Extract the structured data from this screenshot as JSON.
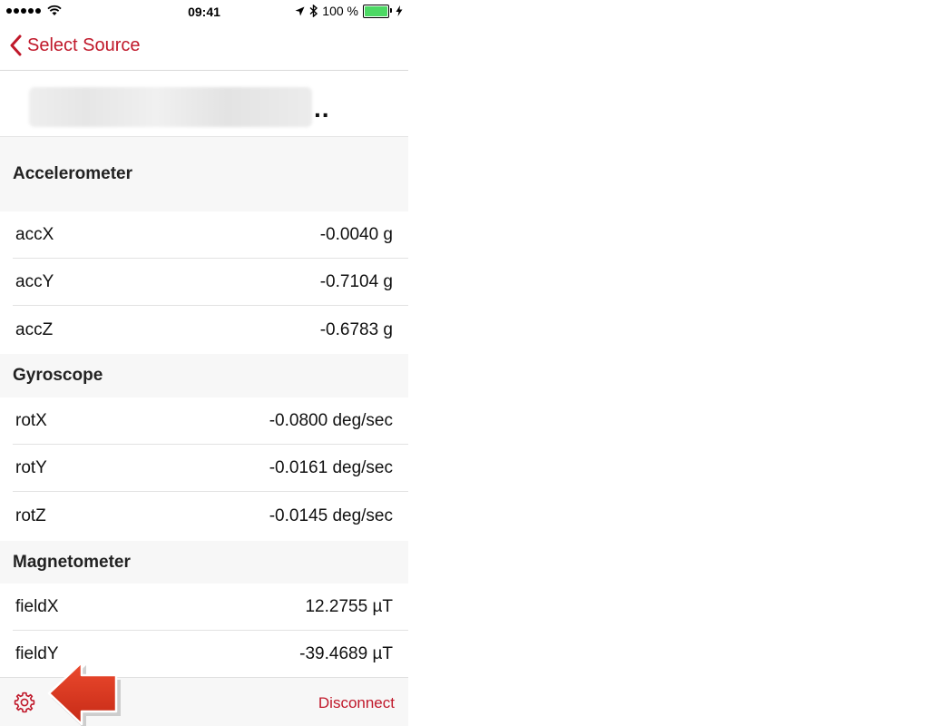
{
  "status_bar": {
    "time": "09:41",
    "battery_text": "100 %",
    "battery_level": 1.0,
    "icons": [
      "signal-dots-icon",
      "wifi-icon",
      "location-arrow-icon",
      "bluetooth-icon",
      "battery-icon",
      "charging-bolt-icon"
    ]
  },
  "nav": {
    "back_label": "Select Source",
    "back_icon": "chevron-left-icon"
  },
  "device": {
    "name_obscured": "(blurred device name)",
    "ellipsis": ".."
  },
  "sections": [
    {
      "title": "Accelerometer",
      "rows": [
        {
          "label": "accX",
          "value": "-0.0040 g"
        },
        {
          "label": "accY",
          "value": "-0.7104 g"
        },
        {
          "label": "accZ",
          "value": "-0.6783 g"
        }
      ]
    },
    {
      "title": "Gyroscope",
      "rows": [
        {
          "label": "rotX",
          "value": "-0.0800 deg/sec"
        },
        {
          "label": "rotY",
          "value": "-0.0161 deg/sec"
        },
        {
          "label": "rotZ",
          "value": "-0.0145 deg/sec"
        }
      ]
    },
    {
      "title": "Magnetometer",
      "rows": [
        {
          "label": "fieldX",
          "value": "12.2755 µT"
        },
        {
          "label": "fieldY",
          "value": "-39.4689 µT"
        }
      ]
    }
  ],
  "toolbar": {
    "settings_icon": "gear-icon",
    "disconnect_label": "Disconnect"
  },
  "annotation": {
    "icon": "red-arrow-icon"
  },
  "colors": {
    "accent": "#c0182a",
    "section_bg": "#f7f7f7",
    "battery_green": "#4cd964",
    "arrow_red": "#d8321e"
  }
}
